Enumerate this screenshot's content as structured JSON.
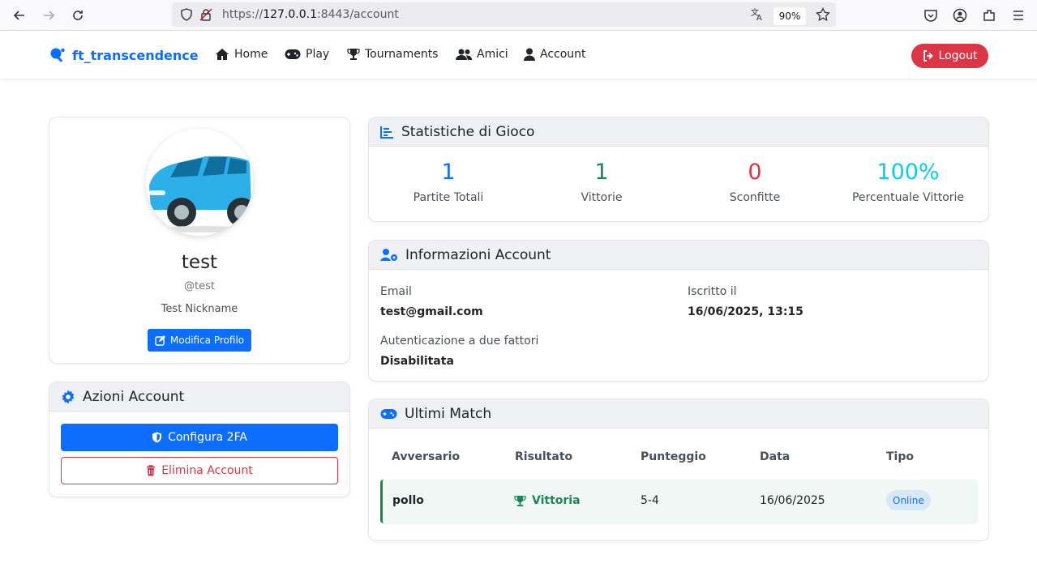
{
  "browser": {
    "url_prefix": "https://",
    "url_host": "127.0.0.1",
    "url_rest": ":8443/account",
    "zoom": "90%"
  },
  "navbar": {
    "brand": "ft_transcendence",
    "items": [
      {
        "label": "Home",
        "icon": "home-icon"
      },
      {
        "label": "Play",
        "icon": "gamepad-icon"
      },
      {
        "label": "Tournaments",
        "icon": "trophy-icon"
      },
      {
        "label": "Amici",
        "icon": "users-icon"
      },
      {
        "label": "Account",
        "icon": "user-icon"
      }
    ],
    "logout": "Logout"
  },
  "profile": {
    "name": "test",
    "username": "@test",
    "nickname": "Test Nickname",
    "edit_button": "Modifica Profilo"
  },
  "actions": {
    "title": "Azioni Account",
    "configure_2fa": "Configura 2FA",
    "delete_account": "Elimina Account"
  },
  "stats": {
    "title": "Statistiche di Gioco",
    "items": [
      {
        "value": "1",
        "label": "Partite Totali",
        "color": "#0d6efd"
      },
      {
        "value": "1",
        "label": "Vittorie",
        "color": "#198754"
      },
      {
        "value": "0",
        "label": "Sconfitte",
        "color": "#dc3545"
      },
      {
        "value": "100%",
        "label": "Percentuale Vittorie",
        "color": "#0dcaf0"
      }
    ]
  },
  "info": {
    "title": "Informazioni Account",
    "email_label": "Email",
    "email_value": "test@gmail.com",
    "joined_label": "Iscritto il",
    "joined_value": "16/06/2025, 13:15",
    "twofa_label": "Autenticazione a due fattori",
    "twofa_value": "Disabilitata"
  },
  "matches": {
    "title": "Ultimi Match",
    "headers": [
      "Avversario",
      "Risultato",
      "Punteggio",
      "Data",
      "Tipo"
    ],
    "rows": [
      {
        "opponent": "pollo",
        "result": "Vittoria",
        "score": "5-4",
        "date": "16/06/2025",
        "type": "Online"
      }
    ]
  },
  "colors": {
    "primary": "#0d6efd",
    "success": "#198754",
    "danger": "#dc3545",
    "info": "#0dcaf0"
  }
}
